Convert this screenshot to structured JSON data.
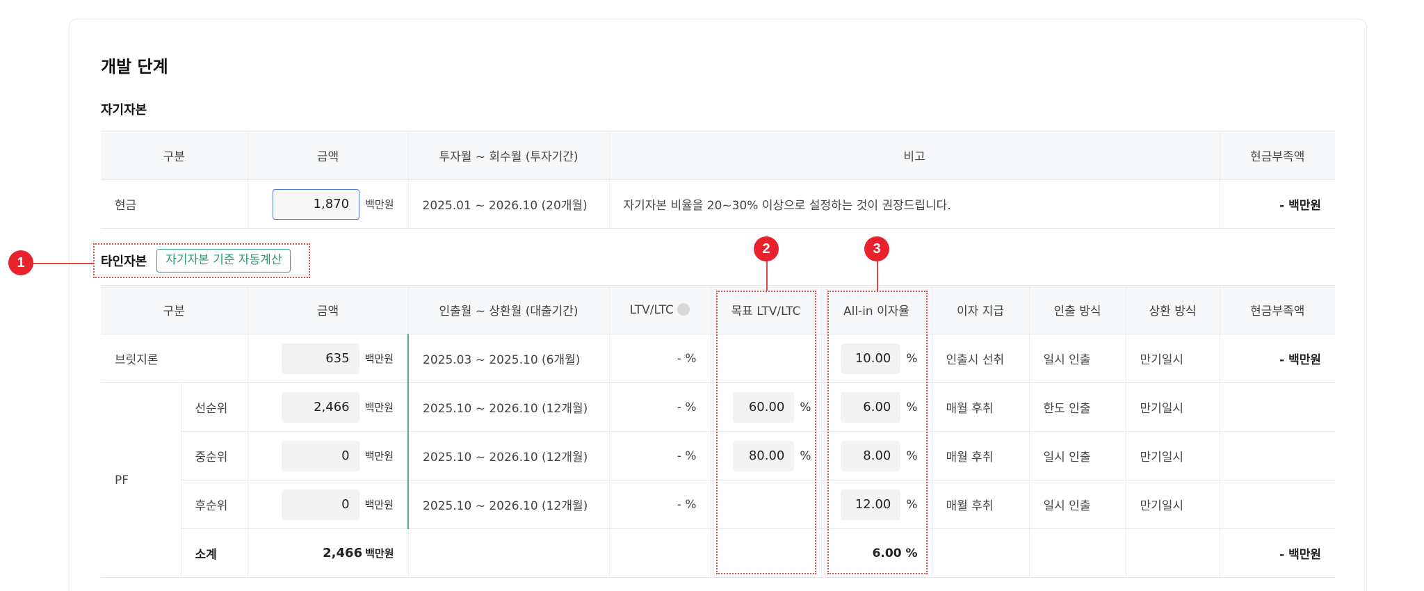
{
  "page": {
    "title": "개발 단계",
    "equity_section": "자기자본",
    "debt_section": "타인자본",
    "auto_calc_label": "자기자본 기준 자동계산"
  },
  "equity_table": {
    "headers": [
      "구분",
      "금액",
      "투자월 ~ 회수월 (투자기간)",
      "비고",
      "현금부족액"
    ],
    "row": {
      "category": "현금",
      "amount": "1,870",
      "unit": "백만원",
      "period": "2025.01 ~ 2026.10 (20개월)",
      "note": "자기자본 비율을 20~30% 이상으로 설정하는 것이 권장드립니다.",
      "shortfall": "- 백만원"
    }
  },
  "debt_table": {
    "headers": [
      "구분",
      "금액",
      "인출월 ~ 상환월 (대출기간)",
      "LTV/LTC",
      "목표 LTV/LTC",
      "All-in 이자율",
      "이자 지급",
      "인출 방식",
      "상환 방식",
      "현금부족액"
    ],
    "unit": "백만원",
    "pct": "%",
    "bridge": {
      "category": "브릿지론",
      "amount": "635",
      "period": "2025.03 ~ 2025.10 (6개월)",
      "ltv": "- %",
      "rate": "10.00",
      "interest": "인출시 선취",
      "draw": "일시 인출",
      "repay": "만기일시",
      "shortfall": "- 백만원"
    },
    "pf_label": "PF",
    "pf_rows": [
      {
        "tranche": "선순위",
        "amount": "2,466",
        "period": "2025.10 ~ 2026.10 (12개월)",
        "ltv": "- %",
        "target": "60.00",
        "rate": "6.00",
        "interest": "매월 후취",
        "draw": "한도 인출",
        "repay": "만기일시"
      },
      {
        "tranche": "중순위",
        "amount": "0",
        "period": "2025.10 ~ 2026.10 (12개월)",
        "ltv": "- %",
        "target": "80.00",
        "rate": "8.00",
        "interest": "매월 후취",
        "draw": "일시 인출",
        "repay": "만기일시"
      },
      {
        "tranche": "후순위",
        "amount": "0",
        "period": "2025.10 ~ 2026.10 (12개월)",
        "ltv": "- %",
        "target": "",
        "rate": "12.00",
        "interest": "매월 후취",
        "draw": "일시 인출",
        "repay": "만기일시"
      }
    ],
    "subtotal": {
      "label": "소계",
      "amount": "2,466",
      "unit": "백만원",
      "rate": "6.00 %",
      "shortfall": "- 백만원"
    }
  },
  "annotations": [
    "1",
    "2",
    "3"
  ],
  "colors": {
    "accent_green": "#3aa983",
    "focus_blue": "#4a7be0",
    "annotation_red": "#e8222d"
  }
}
